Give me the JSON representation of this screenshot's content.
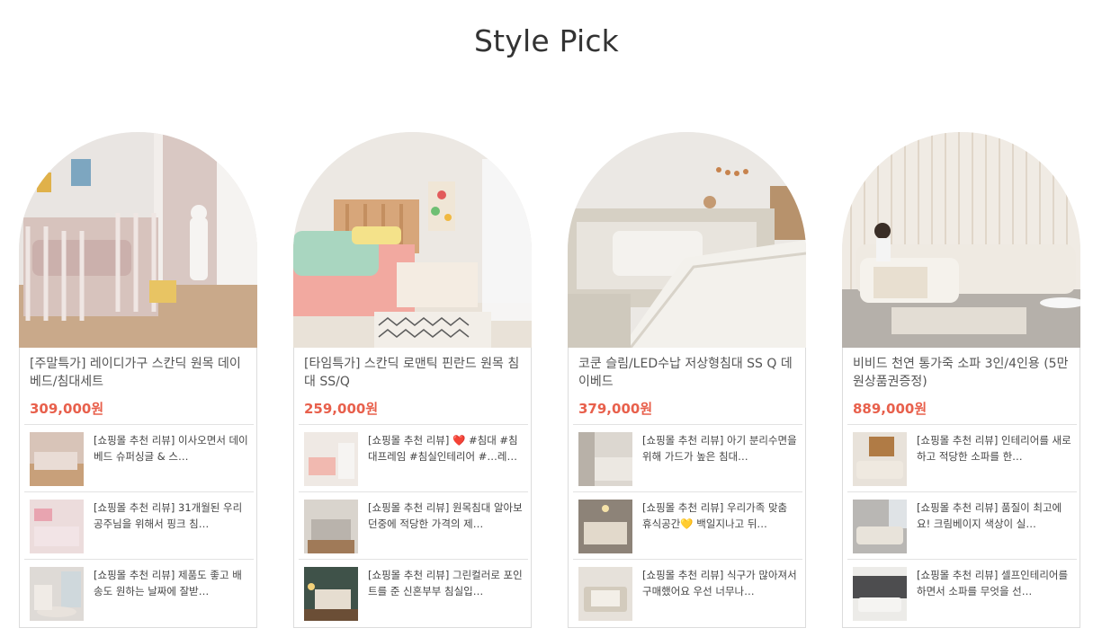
{
  "page": {
    "title": "Style Pick"
  },
  "products": [
    {
      "name": "[주말특가] 레이디가구 스칸딕 원목 데이베드/침대세트",
      "price": "309,000원",
      "image_icon": "kids-daybed-photo",
      "reviews": [
        {
          "text": "[쇼핑몰 추천 리뷰] 이사오면서 데이베드 슈퍼싱글 & 스…"
        },
        {
          "text": "[쇼핑몰 추천 리뷰] 31개월된 우리 공주님을 위해서 핑크 침…"
        },
        {
          "text": "[쇼핑몰 추천 리뷰] 제품도 좋고 배송도 원하는 날짜에 잘받…"
        }
      ]
    },
    {
      "name": "[타임특가] 스칸딕 로맨틱 핀란드 원목 침대 SS/Q",
      "price": "259,000원",
      "image_icon": "wooden-bed-photo",
      "reviews": [
        {
          "text": "[쇼핑몰 추천 리뷰] ❤️ #침대 #침대프레임 #침실인테리어 #…레…"
        },
        {
          "text": "[쇼핑몰 추천 리뷰] 원목침대 알아보던중에 적당한 가격의 제…"
        },
        {
          "text": "[쇼핑몰 추천 리뷰] 그린컬러로 포인트를 준 신혼부부 침실입…"
        }
      ]
    },
    {
      "name": "코쿤 슬림/LED수납 저상형침대 SS Q 데이베드",
      "price": "379,000원",
      "image_icon": "low-bed-photo",
      "reviews": [
        {
          "text": "[쇼핑몰 추천 리뷰] 아기 분리수면을 위해 가드가 높은 침대…"
        },
        {
          "text": "[쇼핑몰 추천 리뷰] 우리가족 맞춤 휴식공간💛 백일지나고 뒤…"
        },
        {
          "text": "[쇼핑몰 추천 리뷰] 식구가 많아져서 구매했어요 우선 너무나…"
        }
      ]
    },
    {
      "name": "비비드 천연 통가죽 소파 3인/4인용 (5만원상품권증정)",
      "price": "889,000원",
      "image_icon": "leather-sofa-photo",
      "reviews": [
        {
          "text": "[쇼핑몰 추천 리뷰] 인테리어를 새로 하고 적당한 소파를 한…"
        },
        {
          "text": "[쇼핑몰 추천 리뷰] 품질이 최고에요! 크림베이지 색상이 실…"
        },
        {
          "text": "[쇼핑몰 추천 리뷰] 셀프인테리어를 하면서 소파를 무엇을 선…"
        }
      ]
    }
  ],
  "colors": {
    "price": "#e8604c",
    "border": "#dcdcdc",
    "title": "#333333"
  }
}
